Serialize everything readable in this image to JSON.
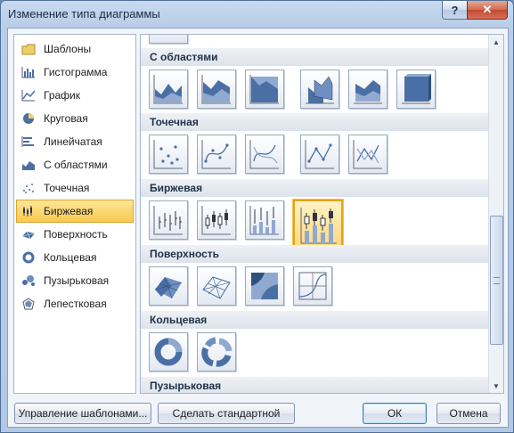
{
  "window": {
    "title": "Изменение типа диаграммы",
    "help_glyph": "?",
    "close_glyph": "✕"
  },
  "sidebar": {
    "items": [
      {
        "label": "Шаблоны",
        "icon": "folder-icon",
        "selected": false
      },
      {
        "label": "Гистограмма",
        "icon": "column-chart-icon",
        "selected": false
      },
      {
        "label": "График",
        "icon": "line-chart-icon",
        "selected": false
      },
      {
        "label": "Круговая",
        "icon": "pie-chart-icon",
        "selected": false
      },
      {
        "label": "Линейчатая",
        "icon": "bar-chart-icon",
        "selected": false
      },
      {
        "label": "С областями",
        "icon": "area-chart-icon",
        "selected": false
      },
      {
        "label": "Точечная",
        "icon": "scatter-chart-icon",
        "selected": false
      },
      {
        "label": "Биржевая",
        "icon": "stock-chart-icon",
        "selected": true
      },
      {
        "label": "Поверхность",
        "icon": "surface-chart-icon",
        "selected": false
      },
      {
        "label": "Кольцевая",
        "icon": "doughnut-chart-icon",
        "selected": false
      },
      {
        "label": "Пузырьковая",
        "icon": "bubble-chart-icon",
        "selected": false
      },
      {
        "label": "Лепестковая",
        "icon": "radar-chart-icon",
        "selected": false
      }
    ]
  },
  "sections": {
    "area": "С областями",
    "scatter": "Точечная",
    "stock": "Биржевая",
    "surface": "Поверхность",
    "doughnut": "Кольцевая",
    "bubble": "Пузырьковая"
  },
  "buttons": {
    "manage_templates": "Управление шаблонами...",
    "set_default": "Сделать стандартной",
    "ok": "ОК",
    "cancel": "Отмена"
  },
  "colors": {
    "selection_fill": "#f9c94e",
    "selection_border": "#d9a52a",
    "chart_blue": "#4a6fa5"
  }
}
